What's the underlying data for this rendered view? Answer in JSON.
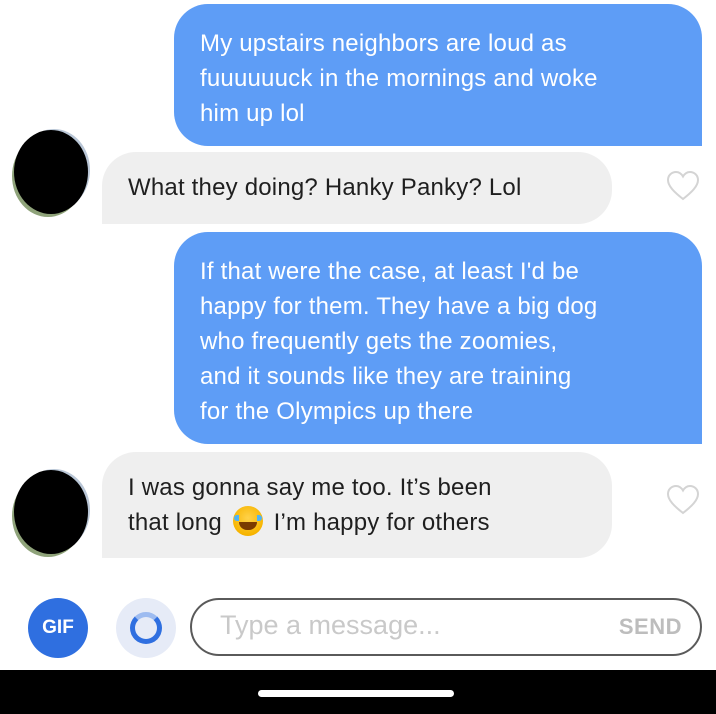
{
  "messages": [
    {
      "direction": "outgoing",
      "lines": [
        "My upstairs neighbors are loud as",
        "fuuuuuuck in the mornings and woke",
        "him up lol"
      ]
    },
    {
      "direction": "incoming",
      "lines": [
        "What  they doing? Hanky Panky? Lol"
      ]
    },
    {
      "direction": "outgoing",
      "lines": [
        "If that were the case, at least I'd be",
        "happy for them. They have a big dog",
        "who frequently gets the zoomies,",
        "and it sounds like they are training",
        "for the Olympics up there"
      ]
    },
    {
      "direction": "incoming",
      "line1": "I was gonna say me too. It’s been",
      "line2_before": "that long",
      "line2_emoji": "face-with-tears-of-joy-icon",
      "line2_after": "I’m happy for others"
    }
  ],
  "composer": {
    "gif_label": "GIF",
    "placeholder": "Type a message...",
    "send_label": "SEND"
  },
  "colors": {
    "outgoing_bubble": "#5e9df6",
    "incoming_bubble": "#efefef",
    "accent": "#2f6fe0"
  }
}
